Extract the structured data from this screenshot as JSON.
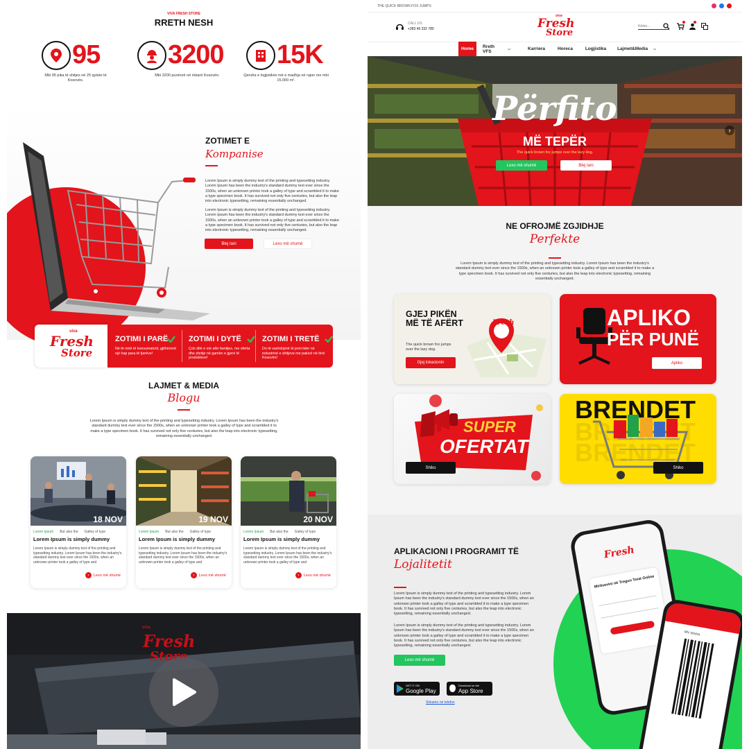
{
  "left": {
    "about": {
      "brand_small": "VIVA FRESH STORE",
      "title": "RRETH NESH",
      "stats": [
        {
          "value": "95",
          "icon": "location-pin-icon",
          "desc": "Mbi 95 pika të shitjes në 25 qytete të Kosovës."
        },
        {
          "value": "3200",
          "icon": "worker-icon",
          "desc": "Mbi 3200 punëorë në mbarë Kosovën."
        },
        {
          "value": "15K",
          "icon": "building-icon",
          "desc": "Qendra e logjistikës më e madhja në rajon me mbi 15,000 m²."
        }
      ]
    },
    "commitments": {
      "title": "ZOTIMET E",
      "script": "Kompanise",
      "para1": "Lorem Ipsum is simply dummy text of the printing and typesetting industry. Lorem Ipsum has been the industry's standard dummy text ever since the 1500s, when an unknown printer took a galley of type and scrambled it to make a type specimen book. It has survived not only five centuries, but also the leap into electronic typesetting, remaining essentially unchanged.",
      "para2": "Lorem Ipsum is simply dummy text of the printing and typesetting industry. Lorem Ipsum has been the industry's standard dummy text ever since the 1500s, when an unknown printer took a galley of type and scrambled it to make a type specimen book. It has survived not only five centuries, but also the leap into electronic typesetting, remaining essentially unchanged.",
      "buy_label": "Blej tani",
      "more_label": "Lexo më shumë",
      "logo": {
        "line1": "viva",
        "line2": "Fresh",
        "line3": "Store"
      },
      "cards": [
        {
          "title": "ZOTIMI I PARË",
          "text": "Në të mirë të konsumatorit, gjithmonë një hap para të tjerëve!"
        },
        {
          "title": "ZOTIMI I DYTË",
          "text": "Çdo ditë e më afër familjes, me oferta dhe zbritje në gamën e gjerë të produkteve!"
        },
        {
          "title": "ZOTIMI I TRETË",
          "text": "Do të vazhdojmë të jemi lider në industrinë e shitjeve me pakicë në tërë Kosovën!"
        }
      ]
    },
    "blog": {
      "title": "LAJMET & MEDIA",
      "script": "Blogu",
      "intro": "Lorem Ipsum is simply dummy text of the printing and typesetting industry. Lorem Ipsum has been the industry's standard dummy text ever since the 1500s, when an unknown printer took a galley of type and scrambled it to make a type specimen book. It has survived not only five centuries, but also the leap into electronic typesetting, remaining essentially unchanged.",
      "posts": [
        {
          "date": "18 NOV",
          "tags": [
            "Lorem Ipsum",
            "But also the",
            "Galley of type"
          ],
          "title": "Lorem Ipsum is simply dummy",
          "text": "Lorem Ipsum is simply dummy text of the printing and typesetting industry. Lorem Ipsum has been the industry's standard dummy text ever since the 1500s, when an unknown printer took a galley of type and",
          "more": "Lexo më shumë"
        },
        {
          "date": "19 NOV",
          "tags": [
            "Lorem Ipsum",
            "But also the",
            "Galley of type"
          ],
          "title": "Lorem Ipsum is simply dummy",
          "text": "Lorem Ipsum is simply dummy text of the printing and typesetting industry. Lorem Ipsum has been the industry's standard dummy text ever since the 1500s, when an unknown printer took a galley of type and",
          "more": "Lexo më shumë"
        },
        {
          "date": "20 NOV",
          "tags": [
            "Lorem Ipsum",
            "But also the",
            "Galley of type"
          ],
          "title": "Lorem Ipsum is simply dummy",
          "text": "Lorem Ipsum is simply dummy text of the printing and typesetting industry. Lorem Ipsum has been the industry's standard dummy text ever since the 1500s, when an unknown printer took a galley of type and",
          "more": "Lexo më shumë"
        }
      ]
    },
    "video": {
      "logo_line1": "viva",
      "logo_line2": "Fresh",
      "logo_line3": "Store"
    }
  },
  "right": {
    "topbar": {
      "tagline": "THE QUICK BROWN FOX JUMPS"
    },
    "header": {
      "call_label": "CALL US",
      "phone": "+383 49 332 780",
      "logo": {
        "line1": "viva",
        "line2": "Fresh",
        "line3": "Store"
      },
      "search_placeholder": "Kërko..."
    },
    "nav": [
      "Home",
      "Rreth VFS",
      "Karriera",
      "Horeca",
      "Logjistika",
      "Lajmet&Media"
    ],
    "hero": {
      "script": "Përfito",
      "subtitle": "MË TEPËR",
      "tagline": "The quick brown fox jumps over the lazy dog.",
      "more_label": "Lexo më shumë",
      "buy_label": "Blej tani"
    },
    "offer": {
      "title": "NE OFROJMË ZGJIDHJE",
      "script": "Perfekte",
      "intro": "Lorem Ipsum is simply dummy text of the printing and typesetting industry. Lorem Ipsum has been the industry's standard dummy text ever since the 1500s, when an unknown printer took a galley of type and scrambled it to make a type specimen book. It has survived not only five centuries, but also the leap into electronic typesetting, remaining essentially unchanged."
    },
    "tiles": {
      "store": {
        "title": "GJEJ PIKËN MË TË AFËRT",
        "text": "The quick brown fox jumps over the lazy dog.",
        "button": "Gjej lokacionin"
      },
      "jobs": {
        "title_line1": "APLIKO",
        "title_line2": "PËR PUNË",
        "button": "Apliko"
      },
      "offers": {
        "line1": "SUPER",
        "line2": "OFERTAT",
        "button": "Shiko"
      },
      "brands": {
        "title": "BRENDET",
        "button": "Shiko"
      }
    },
    "loyalty": {
      "title": "APLIKACIONI I PROGRAMIT TË",
      "script": "Lojalitetit",
      "para1": "Lorem Ipsum is simply dummy text of the printing and typesetting industry. Lorem Ipsum has been the industry's standard dummy text ever since the 1500s, when an unknown printer took a galley of type and scrambled it to make a type specimen book. It has survived not only five centuries, but also the leap into electronic typesetting, remaining essentially unchanged.",
      "para2": "Lorem Ipsum is simply dummy text of the printing and typesetting industry. Lorem Ipsum has been the industry's standard dummy text ever since the 1500s, when an unknown printer took a galley of type and scrambled it to make a type specimen book. It has survived not only five centuries, but also the leap into electronic typesetting, remaining essentially unchanged.",
      "more_label": "Lexo më shumë",
      "google_small": "GET IT ON",
      "google_big": "Google Play",
      "apple_small": "Download on the",
      "apple_big": "App Store",
      "download_link": "Shkarko në telefon",
      "phone_welcome": "Mirësevini në Tregun Tonë Online",
      "phone_card": "MV ekstra"
    }
  }
}
